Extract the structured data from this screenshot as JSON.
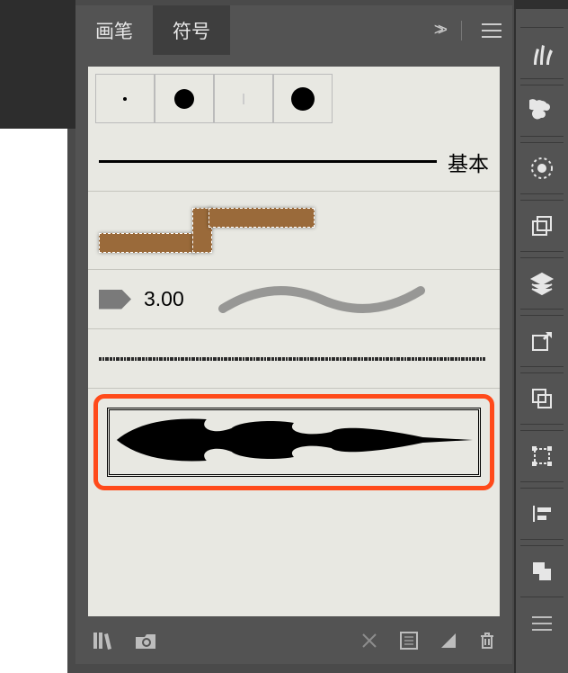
{
  "tabs": {
    "brushes": "画笔",
    "symbols": "符号"
  },
  "basic": {
    "label": "基本"
  },
  "calligraphic": {
    "size": "3.00"
  },
  "icons": {
    "collapse": "collapse-panel-icon",
    "menu": "menu-icon",
    "library": "library-icon",
    "cc": "creative-cloud-icon",
    "break": "break-link-icon",
    "options": "options-icon",
    "new": "new-brush-icon",
    "trash": "delete-icon"
  },
  "rail": {
    "items": [
      "brushes-icon",
      "club-icon",
      "radial-icon",
      "artboards-icon",
      "layers-icon",
      "export-icon",
      "pathfinder-icon",
      "transform-icon",
      "align-icon",
      "shape-modes-icon"
    ]
  },
  "brushes": [
    {
      "type": "dots"
    },
    {
      "type": "basic"
    },
    {
      "type": "pattern-rope"
    },
    {
      "type": "calligraphic",
      "size": "3.00"
    },
    {
      "type": "charcoal-thin"
    },
    {
      "type": "ink-feather",
      "selected": true
    }
  ]
}
